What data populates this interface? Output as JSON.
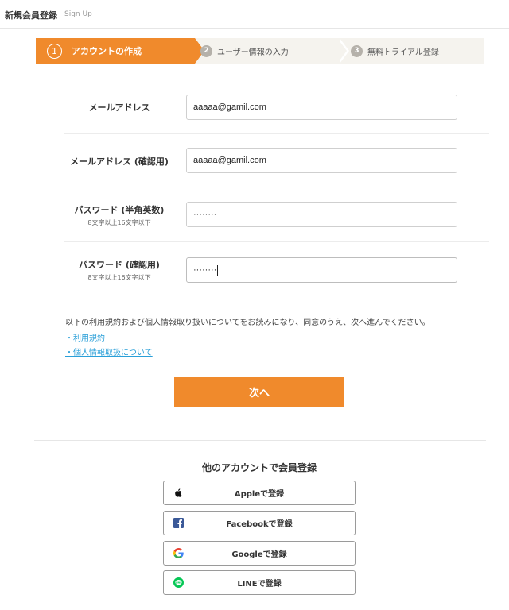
{
  "header": {
    "title": "新規会員登録",
    "subtitle": "Sign Up"
  },
  "steps": [
    {
      "number": "1",
      "label": "アカウントの作成",
      "active": true
    },
    {
      "number": "2",
      "label": "ユーザー情報の入力",
      "active": false
    },
    {
      "number": "3",
      "label": "無料トライアル登録",
      "active": false
    }
  ],
  "form": {
    "email": {
      "label": "メールアドレス",
      "value": "aaaaa@gamil.com"
    },
    "email_confirm": {
      "label": "メールアドレス (確認用)",
      "value": "aaaaa@gamil.com"
    },
    "password": {
      "label": "パスワード (半角英数)",
      "hint": "8文字以上16文字以下",
      "value": "········"
    },
    "password_confirm": {
      "label": "パスワード (確認用)",
      "hint": "8文字以上16文字以下",
      "value": "········"
    }
  },
  "terms": {
    "text": "以下の利用規約および個人情報取り扱いについてをお読みになり、同意のうえ、次へ進んでください。",
    "links": [
      "・利用規約",
      "・個人情報取扱について"
    ]
  },
  "next_button": "次へ",
  "social": {
    "heading": "他のアカウントで会員登録",
    "buttons": [
      {
        "label": "Appleで登録",
        "icon": "apple-icon"
      },
      {
        "label": "Facebookで登録",
        "icon": "facebook-icon"
      },
      {
        "label": "Googleで登録",
        "icon": "google-icon"
      },
      {
        "label": "LINEで登録",
        "icon": "line-icon"
      }
    ]
  },
  "colors": {
    "accent": "#f08a2c",
    "link": "#2a9fd8",
    "step_bg": "#f5f3ee"
  }
}
